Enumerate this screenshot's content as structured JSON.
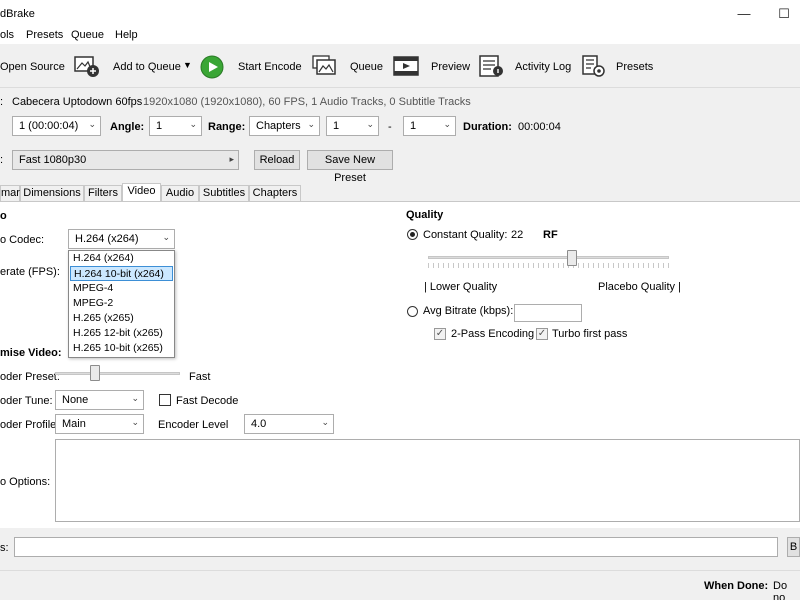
{
  "window": {
    "title": "dBrake",
    "minimize_glyph": "—",
    "maximize_glyph": "☐"
  },
  "menu": [
    "ols",
    "Presets",
    "Queue",
    "Help"
  ],
  "toolbar": {
    "open_source": "Open Source",
    "add_to_queue": "Add to Queue",
    "start_encode": "Start Encode",
    "queue": "Queue",
    "preview": "Preview",
    "activity_log": "Activity Log",
    "presets": "Presets"
  },
  "source": {
    "name": "Cabecera Uptodown 60fps",
    "info": "1920x1080 (1920x1080), 60 FPS, 1 Audio Tracks, 0 Subtitle Tracks"
  },
  "title_row": {
    "title_value": "1 (00:00:04)",
    "angle_label": "Angle:",
    "angle_value": "1",
    "range_label": "Range:",
    "range_type": "Chapters",
    "range_start": "1",
    "range_sep": "-",
    "range_end": "1",
    "duration_label": "Duration:",
    "duration_value": "00:00:04"
  },
  "preset_row": {
    "preset_value": "Fast 1080p30",
    "reload": "Reload",
    "save_new": "Save New Preset"
  },
  "tabs": [
    "mary",
    "Dimensions",
    "Filters",
    "Video",
    "Audio",
    "Subtitles",
    "Chapters"
  ],
  "video": {
    "section_label": "o",
    "codec_label": "o Codec:",
    "codec_value": "H.264 (x264)",
    "codec_options": [
      "H.264 (x264)",
      "H.264 10-bit (x264)",
      "MPEG-4",
      "MPEG-2",
      "H.265 (x265)",
      "H.265 12-bit (x265)",
      "H.265 10-bit (x265)"
    ],
    "highlighted_option": "H.264 10-bit (x264)",
    "framerate_label": "erate (FPS):",
    "optimise_label": "mise Video:",
    "encoder_preset_label": "oder Preset:",
    "encoder_preset_value": "Fast",
    "encoder_preset_position": 0.3,
    "encoder_tune_label": "oder Tune:",
    "encoder_tune_value": "None",
    "fast_decode_label": "Fast Decode",
    "encoder_profile_label": "oder Profile:",
    "encoder_profile_value": "Main",
    "encoder_level_label": "Encoder Level",
    "encoder_level_value": "4.0",
    "extra_options_label": "o Options:"
  },
  "quality": {
    "title": "Quality",
    "constant_quality_label": "Constant Quality:",
    "cq_value": "22",
    "cq_unit": "RF",
    "cq_slider_position": 0.6,
    "lower_quality": "| Lower Quality",
    "placebo_quality": "Placebo Quality |",
    "avg_bitrate_label": "Avg Bitrate (kbps):",
    "two_pass_label": "2-Pass Encoding",
    "turbo_label": "Turbo first pass"
  },
  "destination": {
    "label": "s:",
    "browse_partial": "B"
  },
  "footer": {
    "when_done_label": "When Done:",
    "when_done_value": "Do no"
  },
  "colors": {
    "start_green": "#3aa635",
    "highlight": "#cce8ff",
    "highlight_border": "#3d8fd6"
  }
}
